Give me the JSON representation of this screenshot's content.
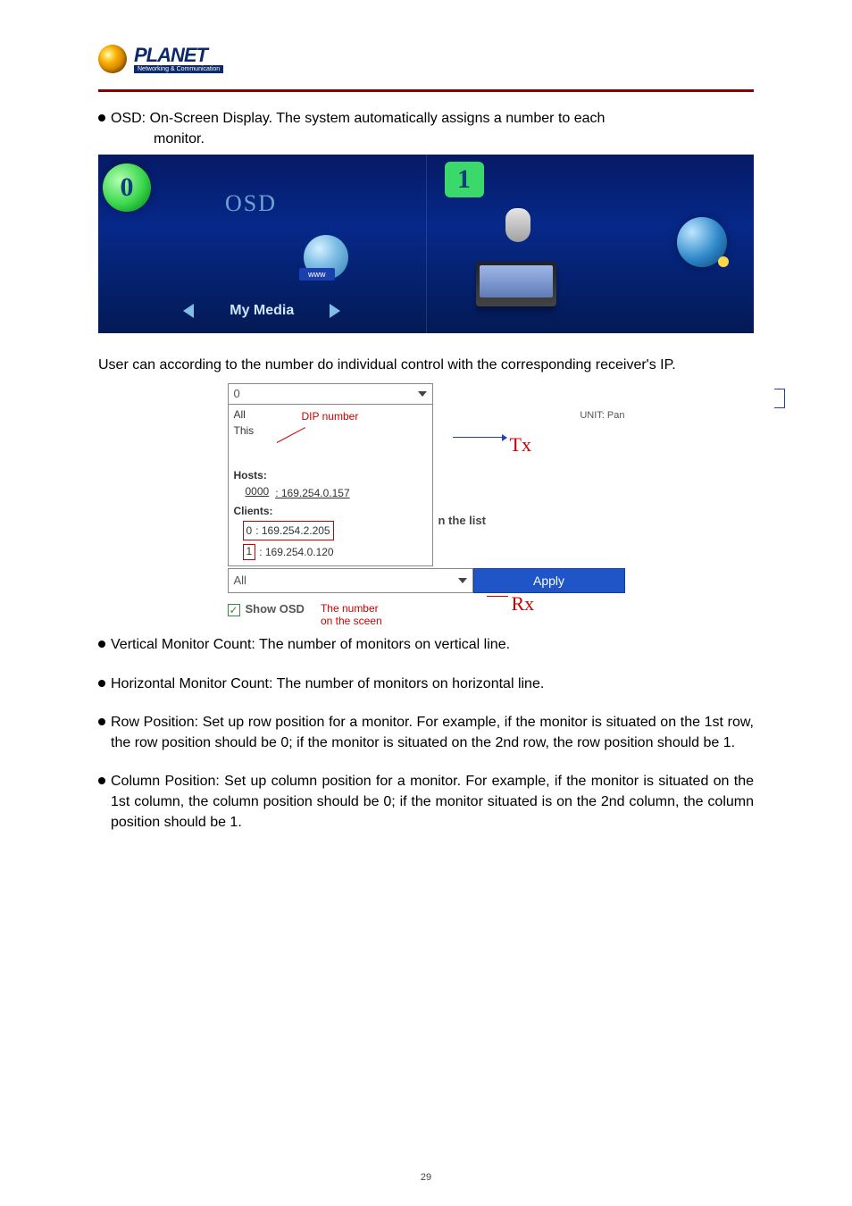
{
  "header": {
    "brand": "PLANET",
    "tagline": "Networking & Communication"
  },
  "bullets": {
    "osd": {
      "label": "OSD:",
      "text_line1": " On-Screen Display. The system automatically assigns a number to each",
      "text_line2": "monitor."
    },
    "vertical": {
      "label": "Vertical Monitor Count:",
      "text": " The number of monitors on vertical line."
    },
    "horizontal": {
      "label": "Horizontal Monitor Count:",
      "text": " The number of monitors on horizontal line."
    },
    "row": {
      "label": "Row Position:",
      "text": " Set up row position for a monitor. For example, if the monitor is situated on the 1st row, the row position should be 0; if the monitor is situated on the 2nd row, the row position should be 1."
    },
    "column": {
      "label": "Column Position:",
      "text": " Set up column position for a monitor. For example, if the monitor is situated on the 1st column, the column position should be 0; if the monitor situated is on the 2nd column, the column position should be 1."
    }
  },
  "osd_strip": {
    "title": "OSD",
    "badge0": "0",
    "badge1": "1",
    "www": "www",
    "my_media": "My Media"
  },
  "mid_para": "User can according to the number do individual control with the corresponding receiver's IP.",
  "panel": {
    "top_value": "0",
    "unit": "UNIT: Pan",
    "dip_label": "DIP number",
    "all": "All",
    "this": "This",
    "hosts": "Hosts:",
    "host0_idx": "0000",
    "host0_ip": ": 169.254.0.157",
    "clients": "Clients:",
    "client0_idx": "0",
    "client0_ip": ": 169.254.2.205",
    "client1_idx": "1",
    "client1_ip": ": 169.254.0.120",
    "in_list": "n the list",
    "all2": "All",
    "apply": "Apply",
    "show_osd": "Show OSD",
    "osd_sub1": "The number",
    "osd_sub2": "on the sceen",
    "tx": "Tx",
    "rx": "Rx"
  },
  "page_number": "29"
}
